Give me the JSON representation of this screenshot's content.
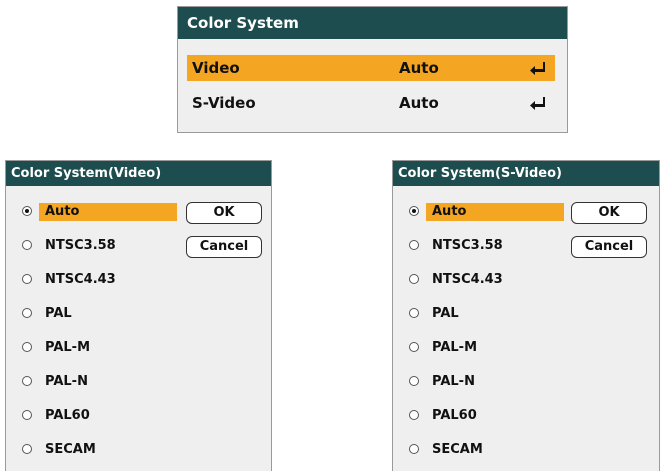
{
  "color_system_menu": {
    "title": "Color System",
    "rows": [
      {
        "label": "Video",
        "value": "Auto",
        "selected": true
      },
      {
        "label": "S-Video",
        "value": "Auto",
        "selected": false
      }
    ]
  },
  "video_dialog": {
    "title": "Color System(Video)",
    "options": [
      "Auto",
      "NTSC3.58",
      "NTSC4.43",
      "PAL",
      "PAL-M",
      "PAL-N",
      "PAL60",
      "SECAM"
    ],
    "selected": "Auto",
    "ok_label": "OK",
    "cancel_label": "Cancel"
  },
  "svideo_dialog": {
    "title": "Color System(S-Video)",
    "options": [
      "Auto",
      "NTSC3.58",
      "NTSC4.43",
      "PAL",
      "PAL-M",
      "PAL-N",
      "PAL60",
      "SECAM"
    ],
    "selected": "Auto",
    "ok_label": "OK",
    "cancel_label": "Cancel"
  },
  "colors": {
    "title_bar": "#1d4d4e",
    "highlight": "#f4a522",
    "panel_bg": "#efefef"
  },
  "icons": [
    "enter-return-icon",
    "radio-button"
  ]
}
